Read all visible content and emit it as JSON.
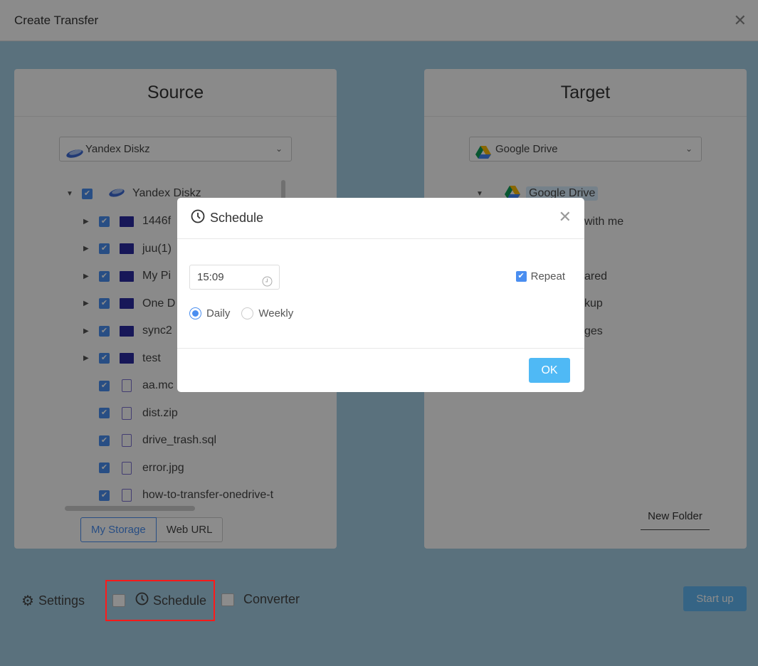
{
  "window": {
    "title": "Create Transfer",
    "close_icon": "close-icon"
  },
  "source": {
    "title": "Source",
    "selected_storage": "Yandex Diskz",
    "tree_root": "Yandex Diskz",
    "folders": [
      "1446f",
      "juu(1)",
      "My Pi",
      "One D",
      "sync2",
      "test"
    ],
    "files": [
      "aa.mc",
      "dist.zip",
      "drive_trash.sql",
      "error.jpg",
      "how-to-transfer-onedrive-t"
    ],
    "tabs": {
      "my_storage": "My Storage",
      "web_url": "Web URL"
    }
  },
  "target": {
    "title": "Target",
    "selected_storage": "Google Drive",
    "tree_root": "Google Drive",
    "visible_items": [
      "with me",
      "ared",
      "kup",
      "ges"
    ],
    "new_folder": "New Folder"
  },
  "footer": {
    "settings": "Settings",
    "schedule": "Schedule",
    "converter": "Converter",
    "start": "Start up",
    "schedule_checked": false,
    "converter_checked": false
  },
  "modal": {
    "title": "Schedule",
    "time": "15:09",
    "repeat_label": "Repeat",
    "repeat_checked": true,
    "options": [
      "Daily",
      "Weekly"
    ],
    "selected": "Daily",
    "ok": "OK"
  },
  "colors": {
    "accent": "#4a8ef0",
    "ok_button": "#4fb9f5",
    "highlight": "#ff1a1a"
  }
}
